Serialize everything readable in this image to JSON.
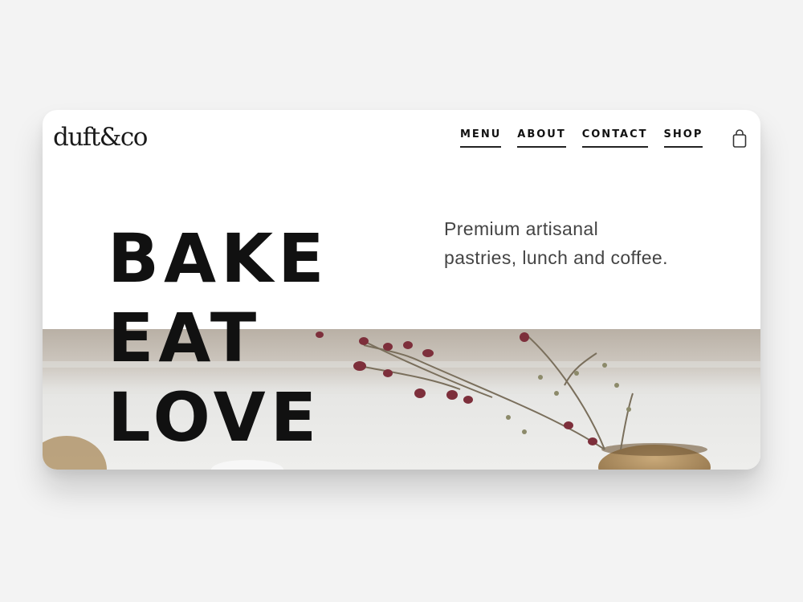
{
  "brand": {
    "logo_text": "duft&co"
  },
  "nav": {
    "items": [
      {
        "label": "MENU"
      },
      {
        "label": "ABOUT"
      },
      {
        "label": "CONTACT"
      },
      {
        "label": "SHOP"
      }
    ],
    "cart_icon": "shopping-bag-icon"
  },
  "hero": {
    "headline_lines": [
      "BAKE",
      "EAT",
      "LOVE"
    ],
    "tagline_lines": [
      "Premium artisanal",
      "pastries, lunch and coffee."
    ],
    "image": "branch-in-bowl-photo"
  },
  "colors": {
    "page_bg": "#f3f3f3",
    "card_bg": "#ffffff",
    "text": "#111111",
    "muted_text": "#444444"
  }
}
